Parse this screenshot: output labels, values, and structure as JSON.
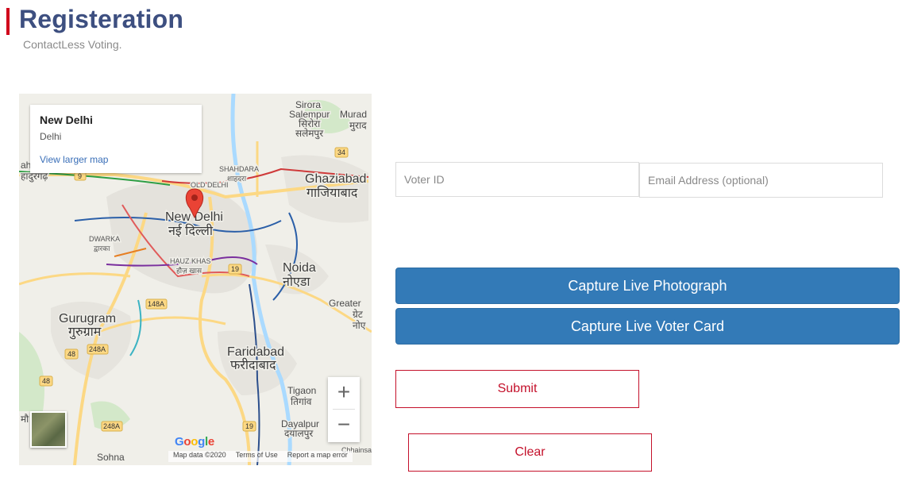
{
  "header": {
    "title": "Registeration",
    "subtitle": "ContactLess Voting."
  },
  "map": {
    "info_card": {
      "title": "New Delhi",
      "subtitle": "Delhi",
      "link": "View larger map"
    },
    "place_labels": {
      "new_delhi_en": "New Delhi",
      "new_delhi_hi": "नई दिल्ली",
      "ghaziabad_en": "Ghaziabad",
      "ghaziabad_hi": "गाजियाबाद",
      "noida_en": "Noida",
      "noida_hi": "नोएडा",
      "gurugram_en": "Gurugram",
      "gurugram_hi": "गुरुग्राम",
      "faridabad_en": "Faridabad",
      "faridabad_hi": "फरीदाबाद",
      "sirora": "Sirora",
      "salempur_en": "Salempur",
      "sirora_hi": "सिरोरा",
      "salempur_hi": "सलेमपुर",
      "murad": "Murad",
      "murad_hi": "मुराद",
      "shahdara_en": "SHAHDARA",
      "shahdara_hi": "शाहदरा",
      "old_delhi": "OLD DELHI",
      "dwarka_en": "DWARKA",
      "dwarka_hi": "द्वारका",
      "hauz_khas_en": "HAUZ KHAS",
      "hauz_khas_hi": "हौज़ खास",
      "greater": "Greater",
      "greater_hi": "ग्रेट",
      "noida_frag": "नोए",
      "tigaon_en": "Tigaon",
      "tigaon_hi": "तिगांव",
      "dayalpur_en": "Dayalpur",
      "dayalpur_hi": "दयालपुर",
      "sohna": "Sohna",
      "left_frag_en": "ah",
      "left_frag_hi": "हादुरगढ़",
      "chhainsa": "Chhainsa",
      "mari": "मौ"
    },
    "road_numbers": {
      "r9": "9",
      "r34": "34",
      "r19a": "19",
      "r19b": "19",
      "r148a": "148A",
      "r248a": "248A",
      "r248a_b": "248A",
      "r48a": "48",
      "r48b": "48"
    },
    "zoom_in": "+",
    "zoom_out": "−",
    "google": [
      "G",
      "o",
      "o",
      "g",
      "l",
      "e"
    ],
    "google_colors": [
      "#4285F4",
      "#EA4335",
      "#FBBC05",
      "#4285F4",
      "#34A853",
      "#EA4335"
    ],
    "attribution": {
      "map_data": "Map data ©2020",
      "terms": "Terms of Use",
      "report": "Report a map error"
    },
    "pin_color": "#ea4335"
  },
  "form": {
    "voter_id_placeholder": "Voter ID",
    "voter_id_value": "",
    "email_placeholder": "Email Address (optional)",
    "email_value": "",
    "capture_photo_label": "Capture Live Photograph",
    "capture_card_label": "Capture Live Voter Card",
    "submit_label": "Submit",
    "clear_label": "Clear"
  },
  "colors": {
    "title": "#3d4f80",
    "accent_bar": "#d0021b",
    "primary_button": "#337ab7",
    "outline_button": "#c4112b"
  }
}
